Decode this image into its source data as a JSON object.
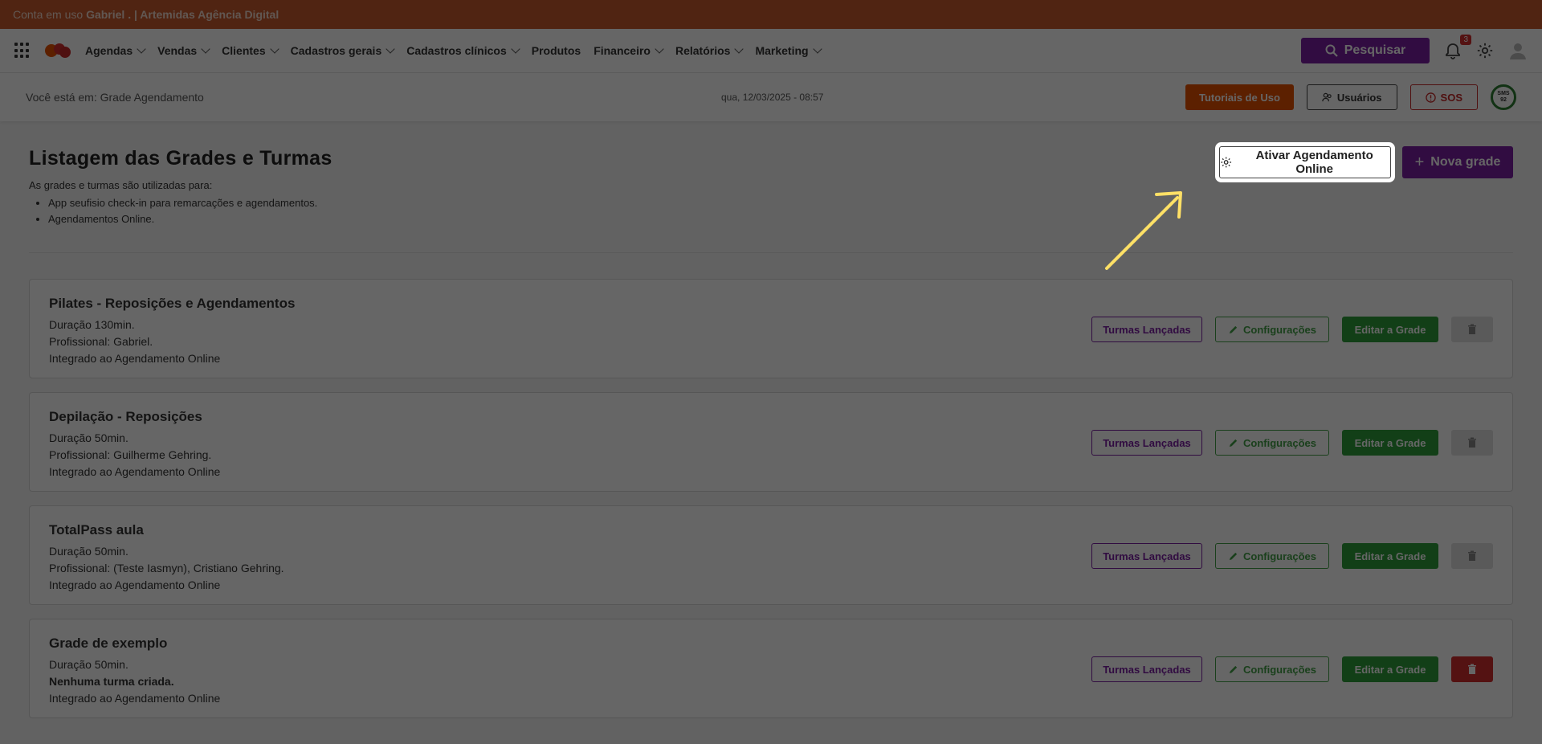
{
  "banner": {
    "prefix": "Conta em uso",
    "account": "Gabriel . | Artemidas Agência Digital"
  },
  "nav": {
    "items": [
      {
        "label": "Agendas",
        "dropdown": true
      },
      {
        "label": "Vendas",
        "dropdown": true
      },
      {
        "label": "Clientes",
        "dropdown": true
      },
      {
        "label": "Cadastros gerais",
        "dropdown": true
      },
      {
        "label": "Cadastros clínicos",
        "dropdown": true
      },
      {
        "label": "Produtos",
        "dropdown": false
      },
      {
        "label": "Financeiro",
        "dropdown": true
      },
      {
        "label": "Relatórios",
        "dropdown": true
      },
      {
        "label": "Marketing",
        "dropdown": true
      }
    ],
    "search_label": "Pesquisar",
    "notification_count": "3"
  },
  "subbar": {
    "location": "Você está em: Grade Agendamento",
    "datetime": "qua, 12/03/2025 - 08:57",
    "tutorials": "Tutoriais de Uso",
    "users": "Usuários",
    "sos": "SOS",
    "sms": "SMS\n92"
  },
  "header": {
    "title": "Listagem das Grades e Turmas",
    "intro": "As grades e turmas são utilizadas para:",
    "bullets": [
      "App seufisio check-in para remarcações e agendamentos.",
      "Agendamentos Online."
    ],
    "activate_online": "Ativar Agendamento Online",
    "new_grade": "Nova grade"
  },
  "actions": {
    "turmas": "Turmas Lançadas",
    "config": "Configurações",
    "edit": "Editar a Grade"
  },
  "grades": [
    {
      "title": "Pilates - Reposições e Agendamentos",
      "lines": [
        "Duração 130min.",
        "Profissional: Gabriel.",
        "Integrado ao Agendamento Online"
      ],
      "bold_line": -1,
      "delete_active": false
    },
    {
      "title": "Depilação - Reposições",
      "lines": [
        "Duração 50min.",
        "Profissional: Guilherme Gehring.",
        "Integrado ao Agendamento Online"
      ],
      "bold_line": -1,
      "delete_active": false
    },
    {
      "title": "TotalPass aula",
      "lines": [
        "Duração 50min.",
        "Profissional: (Teste Iasmyn), Cristiano Gehring.",
        "Integrado ao Agendamento Online"
      ],
      "bold_line": -1,
      "delete_active": false
    },
    {
      "title": "Grade de exemplo",
      "lines": [
        "Duração 50min.",
        "Nenhuma turma criada.",
        "Integrado ao Agendamento Online"
      ],
      "bold_line": 1,
      "delete_active": true
    }
  ],
  "colors": {
    "banner": "#c85a2e",
    "purple": "#7b1fa2",
    "green": "#2e9e3a",
    "orange": "#e65100",
    "red": "#d32f2f",
    "arrow": "#ffe066"
  }
}
